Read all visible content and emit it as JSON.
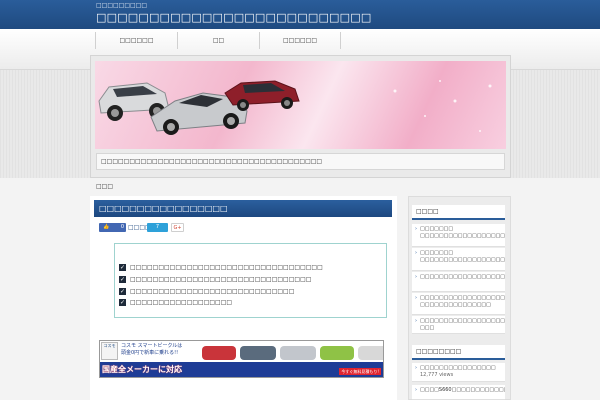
{
  "header": {
    "site_description": "□□□□□□□□□",
    "site_title": "□□□□□□□□□□□□□□□□□□□□□□□□□□"
  },
  "nav": {
    "items": [
      "□□□□□□",
      "□□",
      "□□□□□□"
    ]
  },
  "hero": {
    "caption": "□□□□□□□□□□□□□□□□□□□□□□□□□□□□□□□□□□□□□□□"
  },
  "breadcrumb": "□□□",
  "post": {
    "title": "□□□□□□□□□□□□□□□□□",
    "like_count": "0",
    "share_label": "□□□□",
    "share_count": "7",
    "gplus_label": "G+"
  },
  "checklist": [
    "□□□□□□□□□□□□□□□□□□□□□□□□□□□□□□□□□□",
    "□□□□□□□□□□□□□□□□□□□□□□□□□□□□□□□□",
    "□□□□□□□□□□□□□□□□□□□□□□□□□□□□□",
    "□□□□□□□□□□□□□□□□□□"
  ],
  "ad": {
    "logo_text": "コスモ",
    "copy_line1": "コスモ スマートビークルは",
    "copy_line2": "頭金0円で新車に乗れる!!",
    "bottom_text": "国産全メーカーに対応",
    "cta": "今すぐ無料見積もり!"
  },
  "sidebar": {
    "widget1_title": "□□□□",
    "widget1_items": [
      "□□□□□□□ □□□□□□□□□□□□□□□□□□□□□□□□□□□□",
      "□□□□□□□ □□□□□□□□□□□□□□□□□□□□□□□□□□□□",
      "□□□□□□□□□□□□□□□□□□□□□□□□□□□",
      "□□□□□□□□□□□□□□□□□□□ □□□□□□□□□□□□□□□",
      "□□□□□□□□□□□□□□□□□□□□□□ □□□"
    ],
    "widget2_title": "□□□□□□□□",
    "widget2_items": [
      {
        "label": "□□□□□□□□□□□□□□□□",
        "views": "12,777 views"
      },
      {
        "label": "□□□□S660□□□□□□□□□□□□□□□□□□",
        "views": ""
      }
    ]
  },
  "colors": {
    "header_blue": "#1f4a80",
    "accent_blue": "#2a5d9a",
    "hero_pink": "#f3b7cd",
    "facebook": "#4267b2",
    "checkbox_border": "#9fd3cf"
  }
}
